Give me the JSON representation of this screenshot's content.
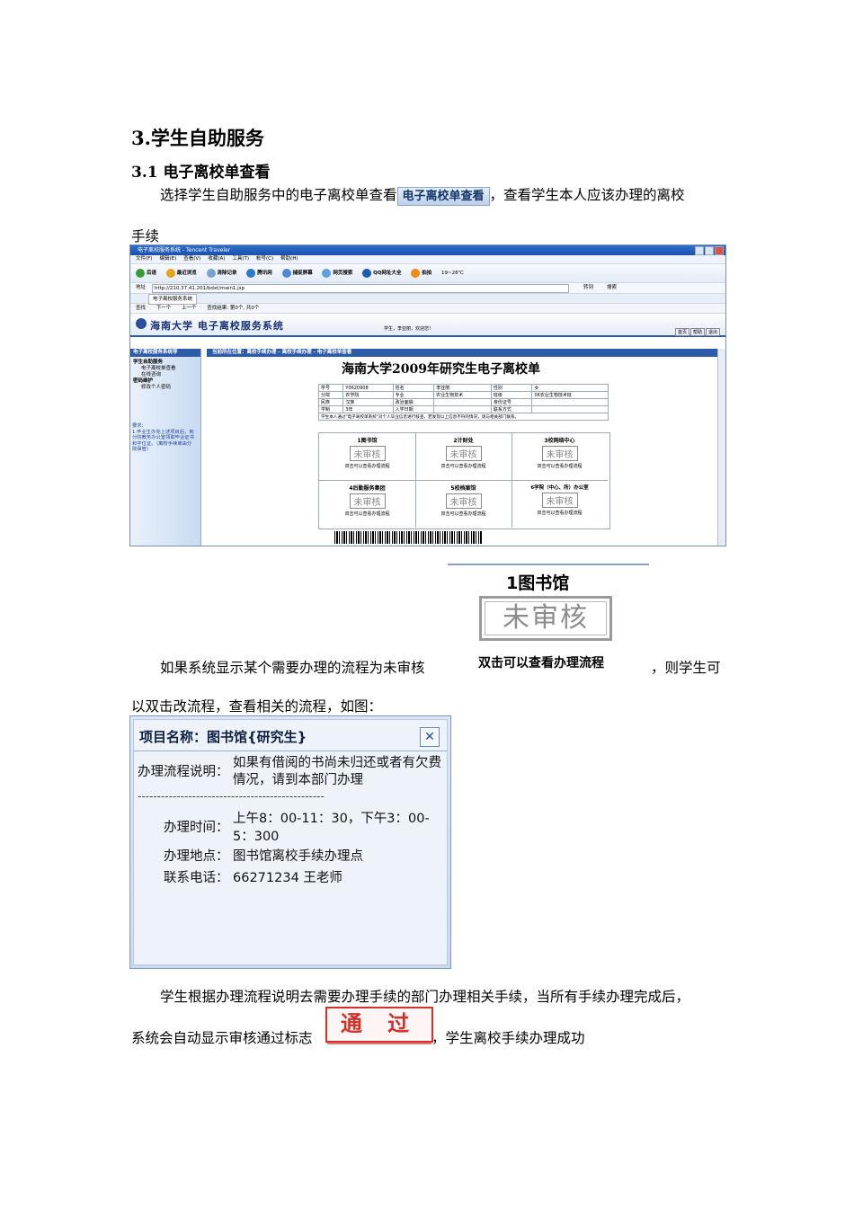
{
  "heading": "3.学生自助服务",
  "subheading": "3.1 电子离校单查看",
  "para1": {
    "before": "选择学生自助服务中的电子离校单查看",
    "button_image_text": "电子离校单查看",
    "after": "，查看学生本人应该办理的离校",
    "line2": "手续"
  },
  "screenshot": {
    "window_title": "电子离校服务系统 - Tencent Traveler",
    "menu": [
      "文件(F)",
      "编辑(E)",
      "查看(V)",
      "收藏(A)",
      "工具(T)",
      "帐号(C)",
      "帮助(H)"
    ],
    "toolbar": [
      "后退",
      "最近浏览",
      "清除记录",
      "腾讯网",
      "捕捉屏幕",
      "网页搜索",
      "QQ网址大全",
      "拍拍",
      "19~28℃"
    ],
    "address_label": "地址",
    "address": "http://210.37.41.201/bdxt/main1.jsp",
    "go": "转到",
    "search": "搜索",
    "tab": "电子离校服务系统",
    "findbar": [
      "查找",
      "下一个",
      "上一个",
      "查找结果: 第0个, 共0个"
    ],
    "site_name": "海南大学  电子离校服务系统",
    "welcome": "学生，李亚丽，欢迎您！",
    "nav_links": [
      "首页",
      "帮助",
      "退出"
    ],
    "sidebar_title": "电子离校服务系统导",
    "sidebar_items": [
      "学生自助服务",
      "电子离校单查看",
      "在线咨询",
      "密码维护",
      "修改个人密码"
    ],
    "breadcrumb": "当前所在位置：离校手续办理 - 离校手续办理 - 电子离校单查看",
    "form_title": "海南大学2009年研究生电子离校单",
    "info_rows": [
      [
        "学号",
        "Y0620908",
        "姓名",
        "李亚丽",
        "性别",
        "女"
      ],
      [
        "分院",
        "农学院",
        "专业",
        "农业生物技术",
        "班级",
        "06农业生物技术班"
      ],
      [
        "民族",
        "汉族",
        "政治面貌",
        "",
        "身份证号",
        ""
      ],
      [
        "学制",
        "3年",
        "入学日期",
        "",
        "联系方式",
        ""
      ]
    ],
    "info_note": "学生本人通过\"电子离校单系统\"对个人毕业信息进行核查，若发现以上信息不符的情况，请与相关部门联系。",
    "hint": "要求:\n1.毕业生办完上述项目后，到分院教务办公室领取毕业证书和学位证。（离校手续单由分院保管）",
    "depts": [
      {
        "name": "1图书馆",
        "stamp": "未审核",
        "note": "双击可以查看办理流程"
      },
      {
        "name": "2计财处",
        "stamp": "未审核",
        "note": "双击可以查看办理流程"
      },
      {
        "name": "3校网络中心",
        "stamp": "未审核",
        "note": "双击可以查看办理流程"
      },
      {
        "name": "4后勤服务集团",
        "stamp": "未审核",
        "note": "双击可以查看办理流程"
      },
      {
        "name": "5校档案馆",
        "stamp": "未审核",
        "note": "双击可以查看办理流程"
      },
      {
        "name": "6学院（中心、所）办公室",
        "stamp": "未审核",
        "note": "双击可以查看办理流程"
      }
    ]
  },
  "library_image": {
    "title": "1图书馆",
    "stamp": "未审核",
    "note": "双击可以查看办理流程"
  },
  "para2": {
    "before": "如果系统显示某个需要办理的流程为未审核",
    "after": "，则学生可",
    "line2": "以双击改流程，查看相关的流程，如图："
  },
  "dialog": {
    "title": "项目名称：图书馆{研究生}",
    "close": "✕",
    "desc_label": "办理流程说明：",
    "desc_line1": "如果有借阅的书尚未归还或者有欠费",
    "desc_line2": "情况，请到本部门办理",
    "separator": "------------------------------------------------",
    "time_label": "办理时间：",
    "time_line1": "上午8：00-11：30，下午3：00-",
    "time_line2": "5：300",
    "place_label": "办理地点：",
    "place": "图书馆离校手续办理点",
    "phone_label": "联系电话：",
    "phone": "66271234 王老师"
  },
  "para3": {
    "line1": "学生根据办理流程说明去需要办理手续的部门办理相关手续，当所有手续办理完成后，",
    "before": "系统会自动显示审核通过标志",
    "stamp": "通 过",
    "after": "，学生离校手续办理成功"
  },
  "colors": {
    "accent": "#2c5ba8",
    "pass_red": "#d0322b",
    "stamp_gray": "#8c8c8c"
  }
}
